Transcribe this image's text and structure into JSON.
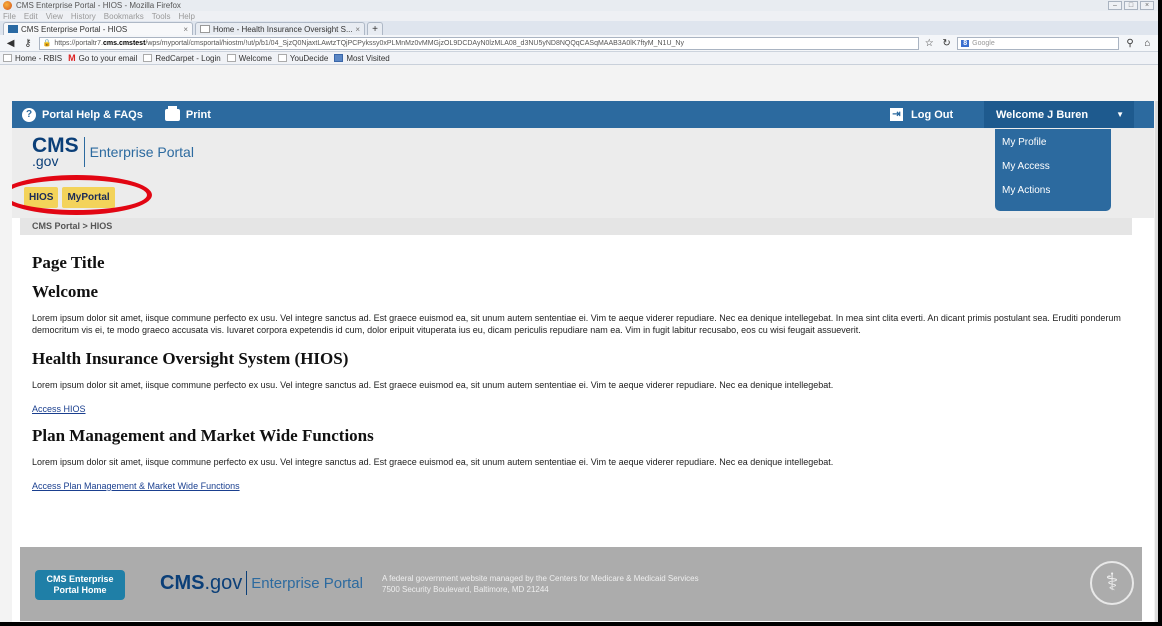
{
  "browser": {
    "window_title": "CMS Enterprise Portal - HIOS - Mozilla Firefox",
    "menu": [
      "File",
      "Edit",
      "View",
      "History",
      "Bookmarks",
      "Tools",
      "Help"
    ],
    "tabs": [
      {
        "label": "CMS Enterprise Portal - HIOS",
        "close": "×"
      },
      {
        "label": "Home - Health Insurance Oversight S...",
        "close": "×"
      }
    ],
    "new_tab": "+",
    "url_prefix": "https://portaltr7.",
    "url_domain": "cms.cmstest",
    "url_rest": "/wps/myportal/cmsportal/hiostm/!ut/p/b1/04_SjzQ0NjaxtLAwtzTQjPCPykssy0xPLMnMz0vMMGjzOL9DCDAyN0lzMLA08_d3NU5yND8NQQqCASqMAAB3A0lK7ftyM_N1U_Ny",
    "search_engine": "8",
    "search_placeholder": "Google",
    "bookmarks": [
      "Home - RBIS",
      "Go to your email",
      "RedCarpet - Login",
      "Welcome",
      "YouDecide",
      "Most Visited"
    ]
  },
  "topbar": {
    "help_label": "Portal Help & FAQs",
    "print_label": "Print",
    "logout_label": "Log Out",
    "welcome_label": "Welcome J Buren"
  },
  "header": {
    "logo_cms": "CMS",
    "logo_gov": ".gov",
    "logo_portal": "Enterprise Portal"
  },
  "user_menu": [
    "My Profile",
    "My Access",
    "My Actions"
  ],
  "portal_tabs": [
    "HIOS",
    "MyPortal"
  ],
  "breadcrumb": "CMS Portal > HIOS",
  "content": {
    "page_title": "Page Title",
    "welcome_heading": "Welcome",
    "welcome_text": "Lorem ipsum dolor sit amet, iisque commune perfecto ex usu. Vel integre sanctus ad. Est graece euismod ea, sit unum autem sententiae ei. Vim te aeque viderer repudiare. Nec ea denique intellegebat. In mea sint clita everti. An dicant primis postulant sea. Eruditi ponderum democritum vis ei, te modo graeco accusata vis. Iuvaret corpora expetendis id cum, dolor eripuit vituperata ius eu, dicam periculis repudiare nam ea. Vim in fugit labitur recusabo, eos cu wisi feugait assueverit.",
    "hios_heading": "Health Insurance Oversight System (HIOS)",
    "hios_text": "Lorem ipsum dolor sit amet, iisque commune perfecto ex usu. Vel integre sanctus ad. Est graece euismod ea, sit unum autem sententiae ei. Vim te aeque viderer repudiare. Nec ea denique intellegebat.",
    "hios_link": "Access HIOS",
    "plan_heading": "Plan Management and Market Wide Functions",
    "plan_text": "Lorem ipsum dolor sit amet, iisque commune perfecto ex usu. Vel integre sanctus ad. Est graece euismod ea, sit unum autem sententiae ei. Vim te aeque viderer repudiare. Nec ea denique intellegebat.",
    "plan_link": "Access Plan Management & Market Wide Functions"
  },
  "footer": {
    "home_button": "CMS Enterprise Portal Home",
    "logo_cms": "CMS",
    "logo_gov": ".gov",
    "logo_portal": "Enterprise Portal",
    "note_line1": "A federal government website managed by the Centers for Medicare & Medicaid Services",
    "note_line2": "7500 Security Boulevard, Baltimore, MD 21244"
  },
  "colors": {
    "nav_blue": "#2c6a9f",
    "tab_yellow": "#f3d35a",
    "annotation_red": "#e20613",
    "footer_gray": "#acacac"
  }
}
